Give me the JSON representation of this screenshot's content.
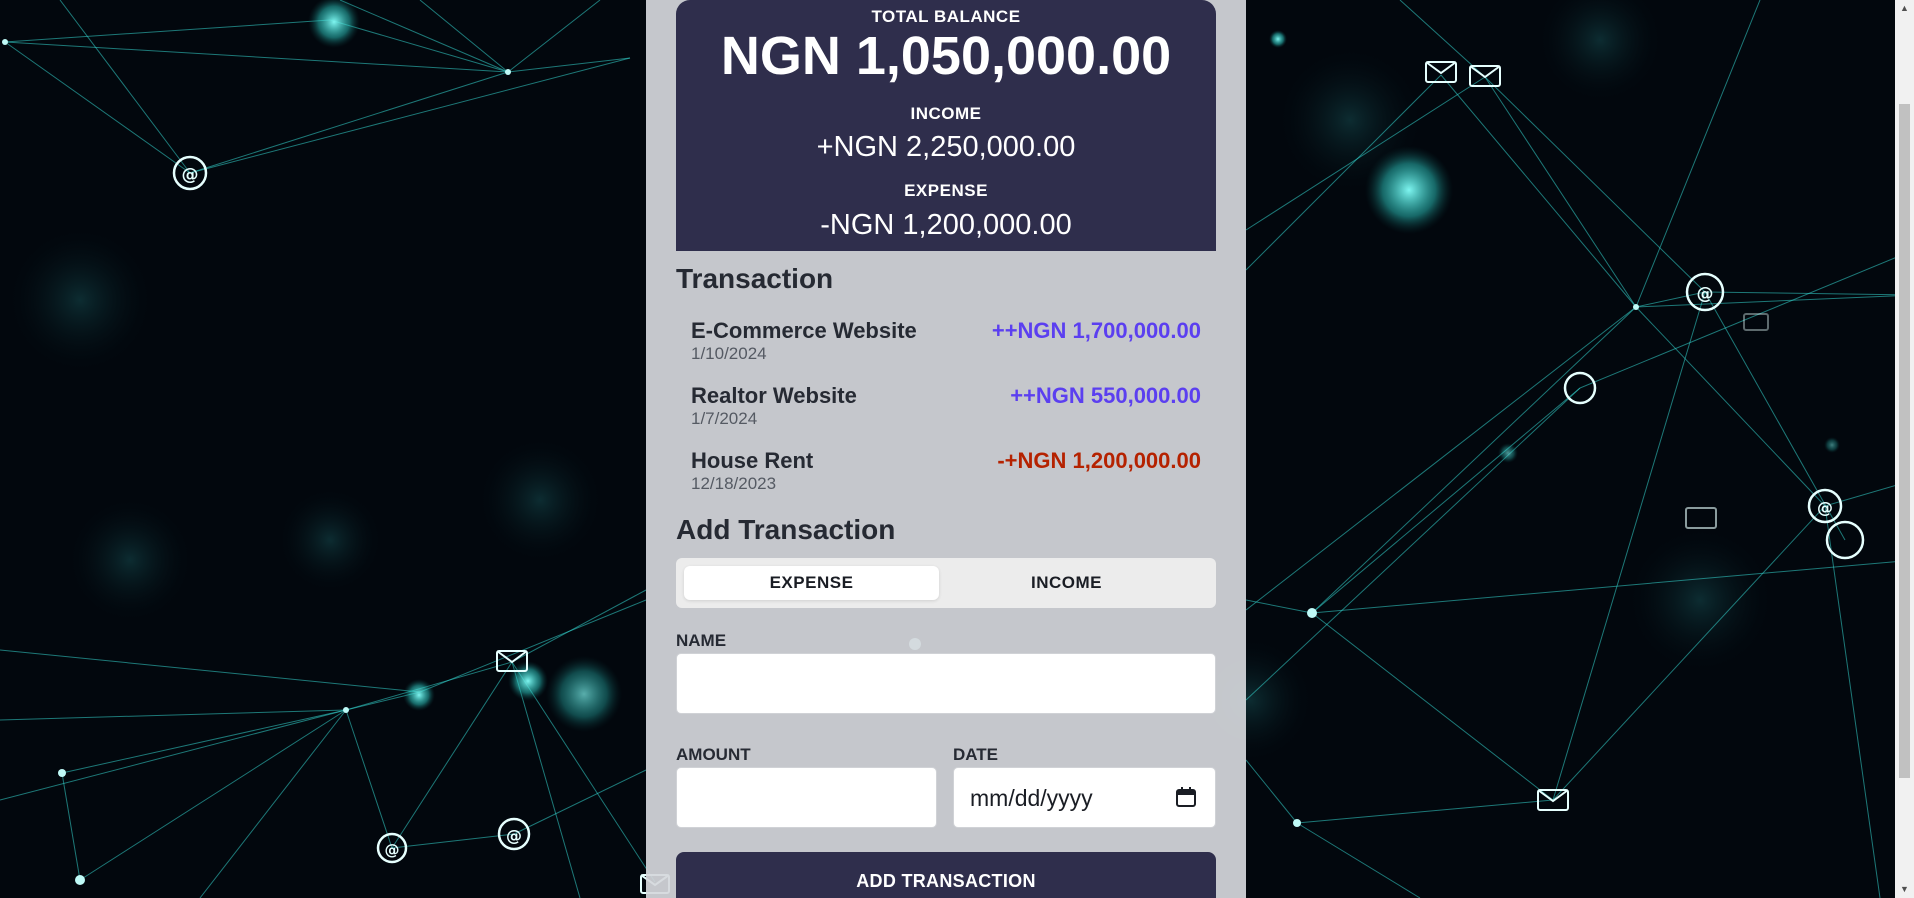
{
  "balance": {
    "total_label": "TOTAL BALANCE",
    "total_value": "NGN 1,050,000.00",
    "income_label": "INCOME",
    "income_value": "+NGN 2,250,000.00",
    "expense_label": "EXPENSE",
    "expense_value": "-NGN 1,200,000.00"
  },
  "transactions": {
    "title": "Transaction",
    "items": [
      {
        "name": "E-Commerce Website",
        "date": "1/10/2024",
        "amount": "++NGN 1,700,000.00",
        "type": "income"
      },
      {
        "name": "Realtor Website",
        "date": "1/7/2024",
        "amount": "++NGN 550,000.00",
        "type": "income"
      },
      {
        "name": "House Rent",
        "date": "12/18/2023",
        "amount": "-+NGN 1,200,000.00",
        "type": "expense"
      }
    ]
  },
  "add_form": {
    "title": "Add Transaction",
    "toggle": {
      "expense_label": "EXPENSE",
      "income_label": "INCOME",
      "active": "expense"
    },
    "name_label": "NAME",
    "name_value": "",
    "amount_label": "AMOUNT",
    "amount_value": "",
    "date_label": "DATE",
    "date_placeholder": "mm/dd/yyyy",
    "submit_label": "ADD TRANSACTION"
  },
  "colors": {
    "card": "#2f2e4c",
    "income": "#5b3ff0",
    "expense": "#b52200",
    "panel": "#d6d8dc",
    "network_line": "#35d6d0",
    "network_node": "#7ff5f0"
  },
  "background_icons": [
    "envelope-icon",
    "at-sign-icon",
    "network-node-icon"
  ]
}
